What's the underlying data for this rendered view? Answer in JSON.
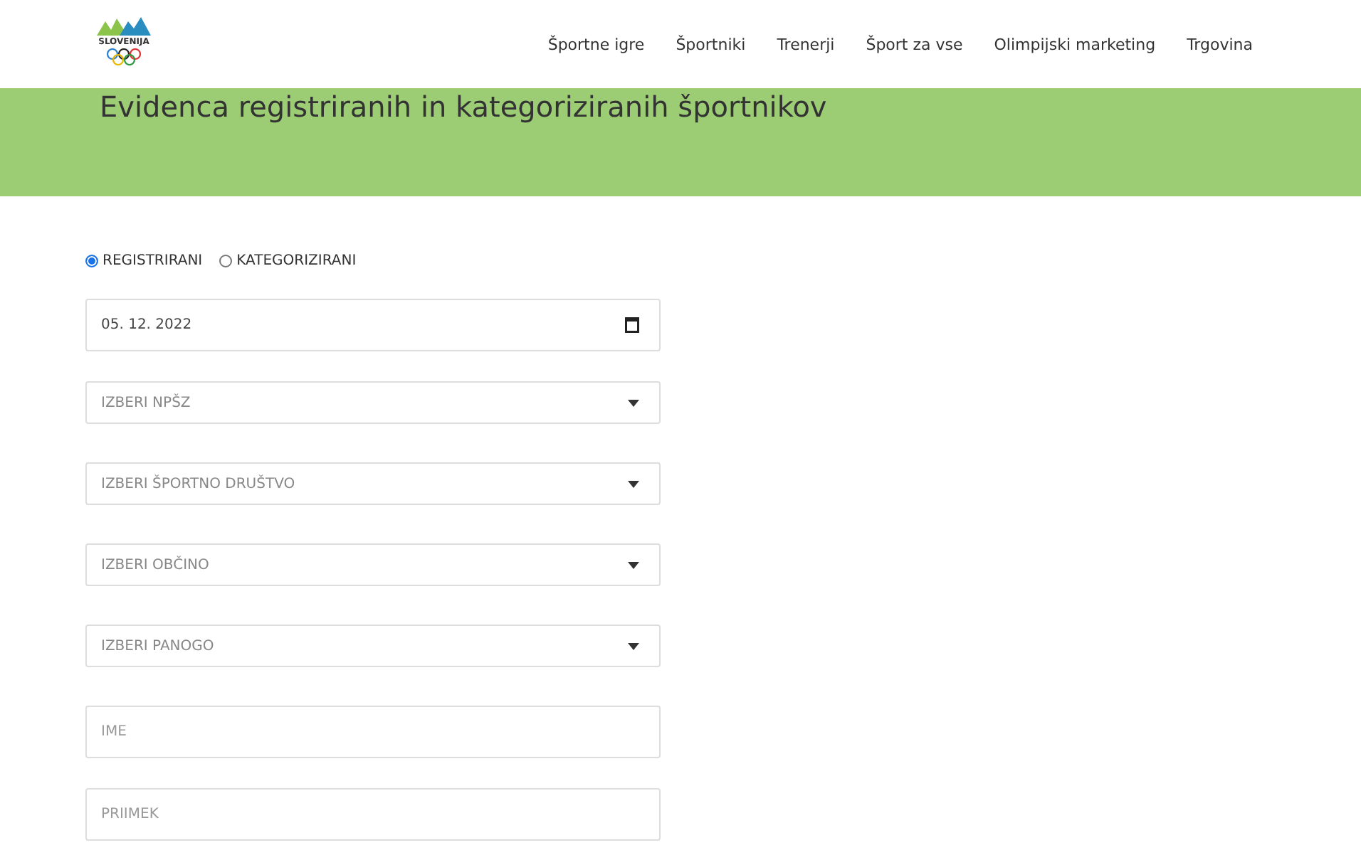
{
  "logo": {
    "text": "SLOVENIJA"
  },
  "nav": [
    "Športne igre",
    "Športniki",
    "Trenerji",
    "Šport za vse",
    "Olimpijski marketing",
    "Trgovina"
  ],
  "banner": {
    "title": "Evidenca registriranih in kategoriziranih športnikov"
  },
  "radios": [
    {
      "label": "REGISTRIRANI",
      "selected": true
    },
    {
      "label": "KATEGORIZIRANI",
      "selected": false
    }
  ],
  "fields": [
    {
      "kind": "date",
      "value": "05. 12. 2022"
    },
    {
      "kind": "select",
      "placeholder": "IZBERI NPŠZ"
    },
    {
      "kind": "select",
      "placeholder": "IZBERI ŠPORTNO DRUŠTVO"
    },
    {
      "kind": "select",
      "placeholder": "IZBERI OBČINO"
    },
    {
      "kind": "select",
      "placeholder": "IZBERI PANOGO"
    },
    {
      "kind": "text",
      "placeholder": "IME"
    },
    {
      "kind": "text",
      "placeholder": "PRIIMEK"
    }
  ]
}
